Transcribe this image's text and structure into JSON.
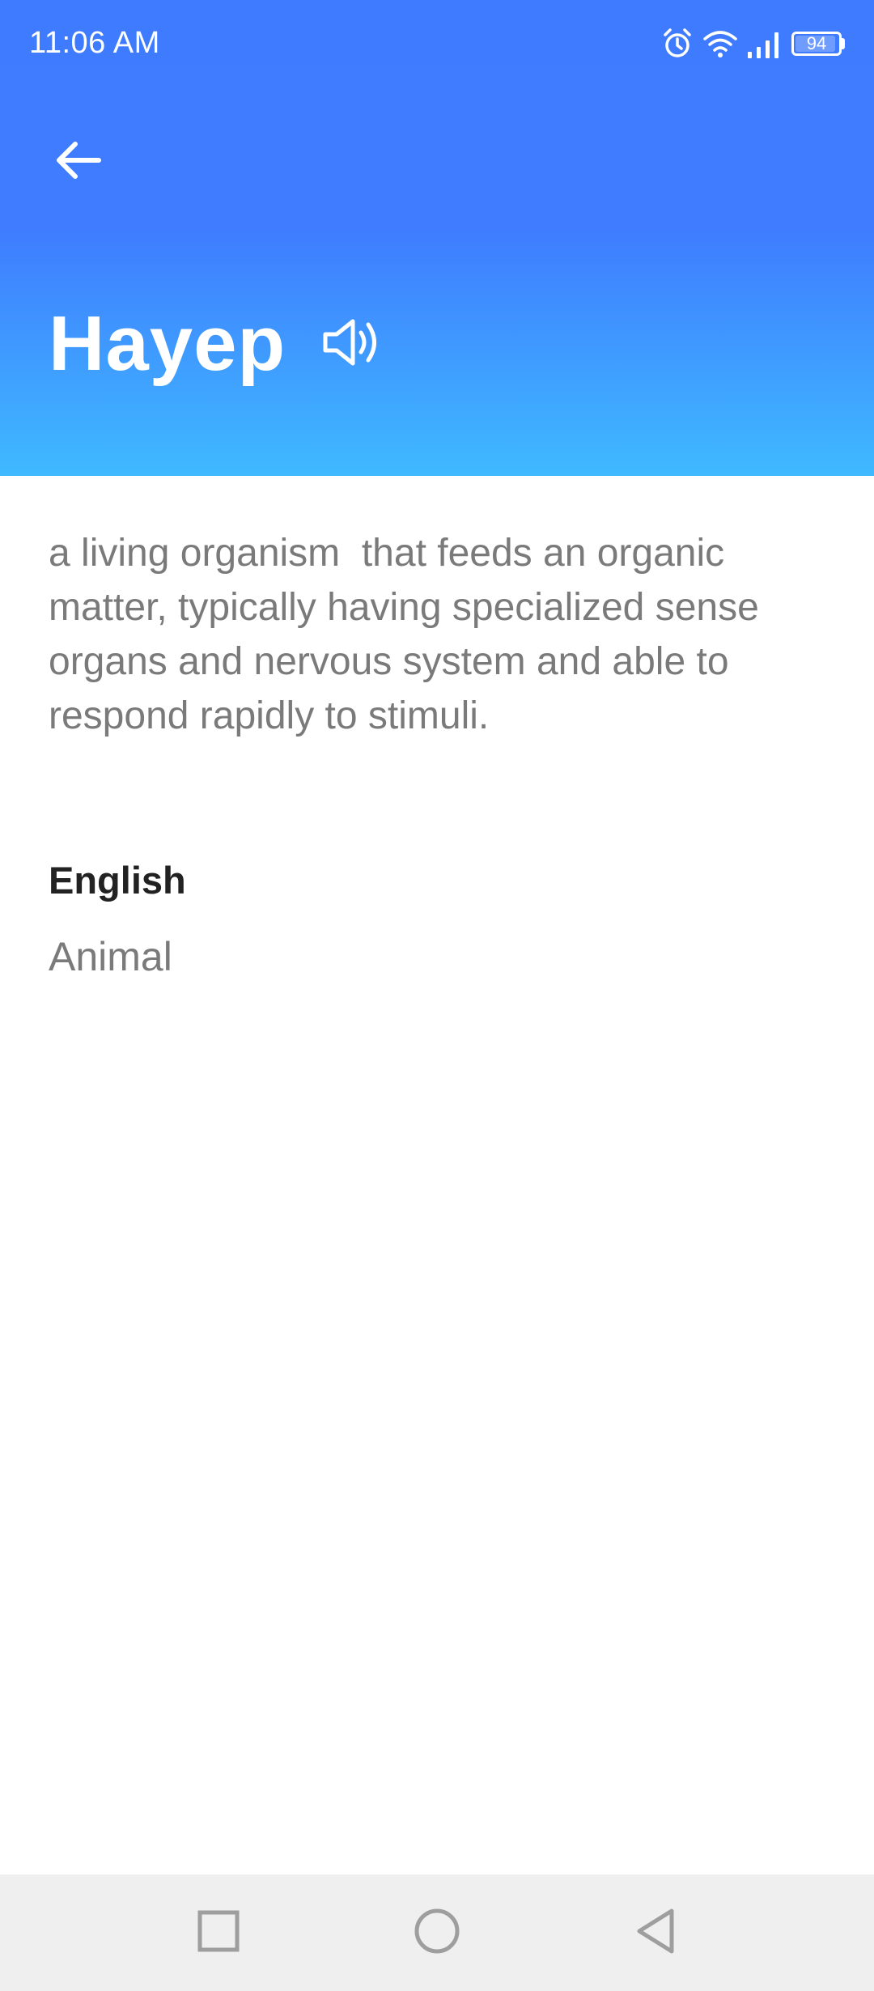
{
  "status_bar": {
    "time": "11:06 AM",
    "battery_level": "94",
    "battery_fraction": 0.94,
    "icons": [
      "alarm-icon",
      "wifi-icon",
      "cellular-signal-icon",
      "battery-icon"
    ]
  },
  "header": {
    "back_icon": "arrow-left-icon",
    "word": "Hayep",
    "speaker_icon": "speaker-icon",
    "gradient_top": "#3f7bff",
    "gradient_bottom": "#3fb9ff"
  },
  "entry": {
    "definition": "a living organism  that feeds an organic matter, typically having specialized sense organs and nervous system and able to respond rapidly to stimuli.",
    "language_heading": "English",
    "translation": "Animal"
  },
  "nav_bar": {
    "icons": [
      "recents-square-icon",
      "home-circle-icon",
      "back-triangle-icon"
    ]
  }
}
